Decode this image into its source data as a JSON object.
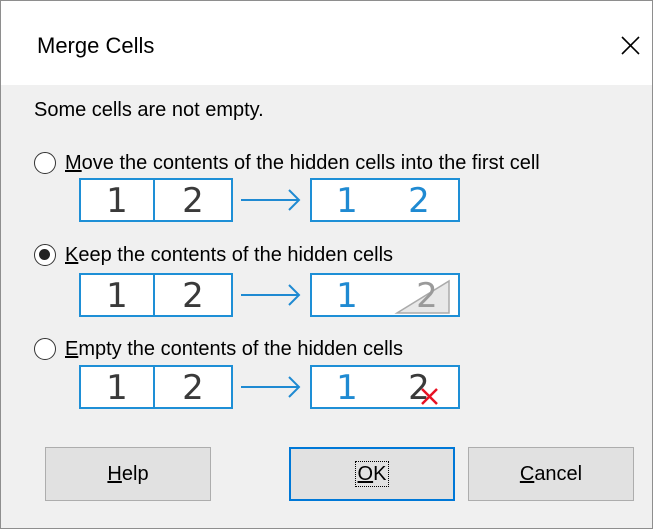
{
  "dialog": {
    "title": "Merge Cells",
    "close_icon": "close-icon",
    "message": "Some cells are not empty."
  },
  "options": [
    {
      "mnemonic": "M",
      "rest": "ove the contents of the hidden cells into the first cell",
      "checked": false,
      "illustration": {
        "left": [
          "1",
          "2"
        ],
        "right": [
          "1",
          "2"
        ],
        "result": "moved"
      }
    },
    {
      "mnemonic": "K",
      "rest": "eep the contents of the hidden cells",
      "checked": true,
      "illustration": {
        "left": [
          "1",
          "2"
        ],
        "right": [
          "1",
          "2"
        ],
        "result": "kept-hidden"
      }
    },
    {
      "mnemonic": "E",
      "rest": "mpty the contents of the hidden cells",
      "checked": false,
      "illustration": {
        "left": [
          "1",
          "2"
        ],
        "right": [
          "1",
          "2"
        ],
        "result": "emptied"
      }
    }
  ],
  "buttons": {
    "help": {
      "mnemonic": "H",
      "rest": "elp"
    },
    "ok": {
      "mnemonic": "O",
      "rest": "K"
    },
    "cancel": {
      "mnemonic": "C",
      "rest": "ancel"
    }
  },
  "colors": {
    "accent": "#0078d7",
    "cell_border": "#1e8fd6",
    "digit_dark": "#3a3a3a",
    "digit_blue": "#1f8ad2",
    "hidden_gray": "#9a9a9a",
    "delete_red": "#e81123"
  }
}
